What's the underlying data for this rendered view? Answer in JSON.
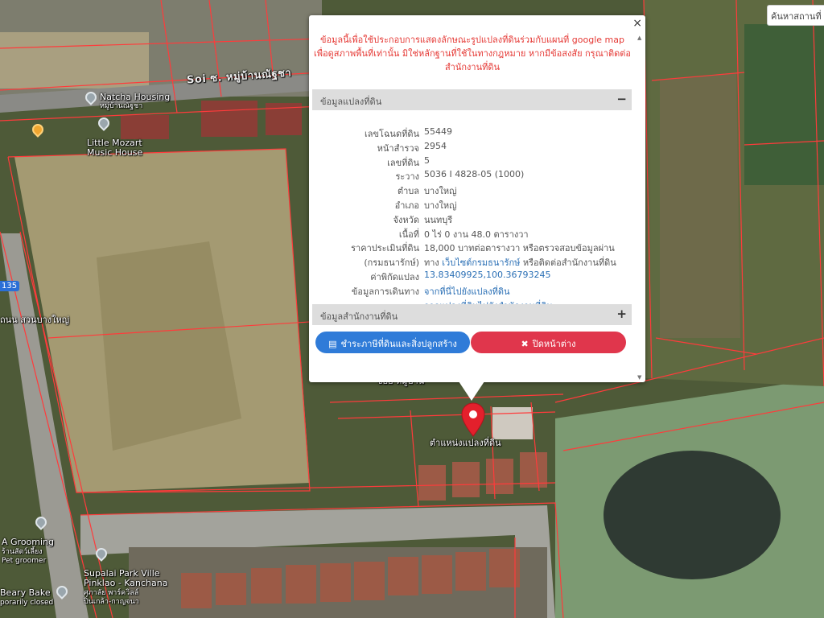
{
  "map": {
    "labels": {
      "road_top": "Soi ซ. หมู่บ้านณัฐชา",
      "natcha": "Natcha Housing",
      "natcha_sub": "หมู่บ้านณัฐชา",
      "mozart_1": "Little Mozart",
      "mozart_2": "Music House",
      "road_left": "ถนน สวนบางใหญ่",
      "grooming_1": "A Grooming",
      "grooming_2": "ร้านสัตว์เลี้ยง",
      "grooming_3": "Pet groomer",
      "supalai_1": "Supalai Park Ville",
      "supalai_2": "Pinklao - Kanchana",
      "supalai_3": "ศุภาลัย พาร์ควิลล์",
      "supalai_4": "ปิ่นเกล้า-กาญจนา",
      "beary_1": "Beary Bake",
      "beary_2": "porarily closed",
      "road_mid": "ซอย หมู่บ้าน",
      "marker_caption": "ตำแหน่งแปลงที่ดิน"
    },
    "route_badge": "135",
    "search_placeholder": "ค้นหาสถานที่"
  },
  "popup": {
    "close_icon": "×",
    "notice": "ข้อมูลนี้เพื่อใช้ประกอบการแสดงลักษณะรูปแปลงที่ดินร่วมกับแผนที่ google map เพื่อดูสภาพพื้นที่เท่านั้น มิใช่หลักฐานที่ใช้ในทางกฎหมาย หากมีข้อสงสัย กรุณาติดต่อสำนักงานที่ดิน",
    "section1_title": "ข้อมูลแปลงที่ดิน",
    "section1_toggle": "−",
    "rows": [
      {
        "key": "เลขโฉนดที่ดิน",
        "value": "55449"
      },
      {
        "key": "หน้าสำรวจ",
        "value": "2954"
      },
      {
        "key": "เลขที่ดิน",
        "value": "5"
      },
      {
        "key": "ระวาง",
        "value": "5036 I 4828-05 (1000)"
      },
      {
        "key": "ตำบล",
        "value": "บางใหญ่"
      },
      {
        "key": "อำเภอ",
        "value": "บางใหญ่"
      },
      {
        "key": "จังหวัด",
        "value": "นนทบุรี"
      },
      {
        "key": "เนื้อที่",
        "value": "0 ไร่ 0 งาน 48.0 ตารางวา"
      },
      {
        "key": "ราคาประเมินที่ดิน",
        "value": "18,000 บาทต่อตารางวา หรือตรวจสอบข้อมูลผ่าน"
      },
      {
        "key": "(กรมธนารักษ์)",
        "value_prefix": "ทาง ",
        "value_link": "เว็บไซต์กรมธนารักษ์",
        "value_suffix": " หรือติดต่อสำนักงานที่ดิน"
      },
      {
        "key": "ค่าพิกัดแปลง",
        "value_link": "13.83409925,100.36793245"
      },
      {
        "key": "ข้อมูลการเดินทาง",
        "value_link": "จากที่นี่ไปยังแปลงที่ดิน"
      },
      {
        "key": "",
        "value_link": "จากแปลงที่ดินไปยังสำนักงานที่ดิน"
      }
    ],
    "section2_title": "ข้อมูลสำนักงานที่ดิน",
    "section2_toggle": "+",
    "btn_tax_icon": "▤",
    "btn_tax_label": "ชำระภาษีที่ดินและสิ่งปลูกสร้าง",
    "btn_close_icon": "✖",
    "btn_close_label": "ปิดหน้าต่าง"
  }
}
